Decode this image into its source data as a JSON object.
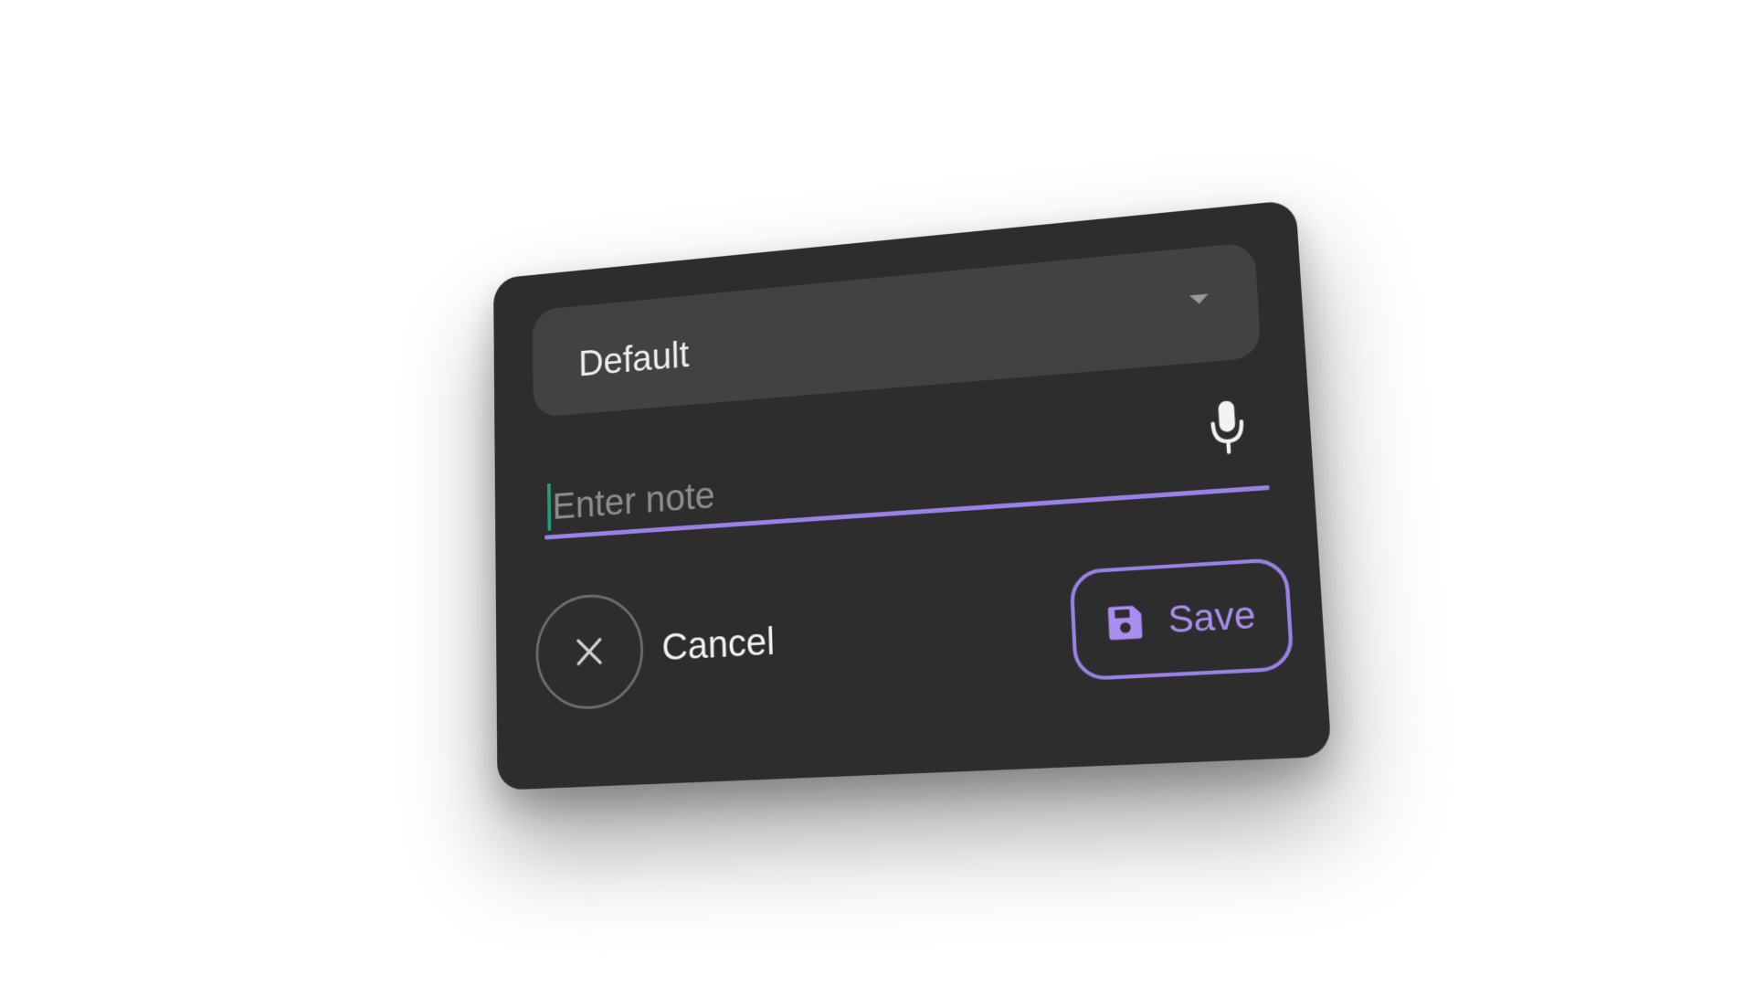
{
  "dropdown": {
    "selected_value": "Default",
    "caret_icon": "caret-down-icon"
  },
  "note": {
    "placeholder": "Enter note",
    "value": "",
    "mic_icon": "microphone-icon"
  },
  "actions": {
    "cancel_label": "Cancel",
    "cancel_icon": "close-icon",
    "save_label": "Save",
    "save_icon": "floppy-disk-icon"
  },
  "colors": {
    "card_background": "#2d2d2d",
    "field_background": "#424242",
    "accent": "#9b80e6",
    "cursor": "#1fa07e",
    "text_primary": "#eeeeee",
    "text_placeholder": "#8d8d8d"
  }
}
